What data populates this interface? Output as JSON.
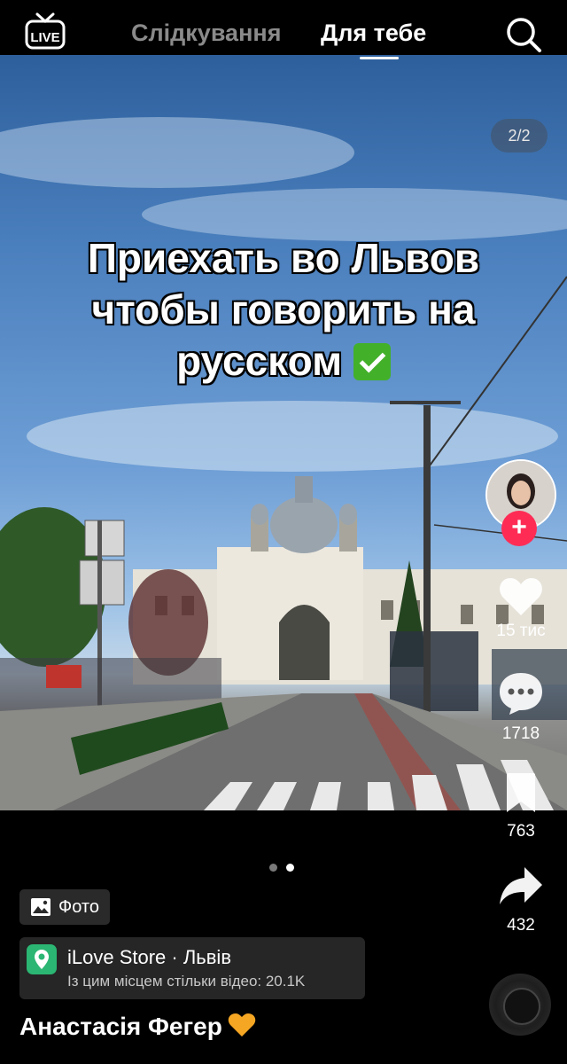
{
  "header": {
    "live_label": "LIVE",
    "tab_following": "Слідкування",
    "tab_for_you": "Для тебе"
  },
  "post": {
    "photo_counter": "2/2",
    "overlay_text": "Приехать во Львов\nчтобы говорить на\nрусском",
    "caption_badge": "Фото",
    "location_title": "iLove Store · Львів",
    "location_subtitle": "Із цим місцем стільки відео: 20.1K",
    "author": "Анастасія Фегер",
    "carousel_dots": 2,
    "carousel_active_index": 1
  },
  "actions": {
    "likes": "15 тис",
    "comments": "1718",
    "saves": "763",
    "shares": "432"
  },
  "colors": {
    "accent_red": "#fe2c55",
    "location_green": "#2bb673",
    "heart_orange": "#f5a623"
  }
}
